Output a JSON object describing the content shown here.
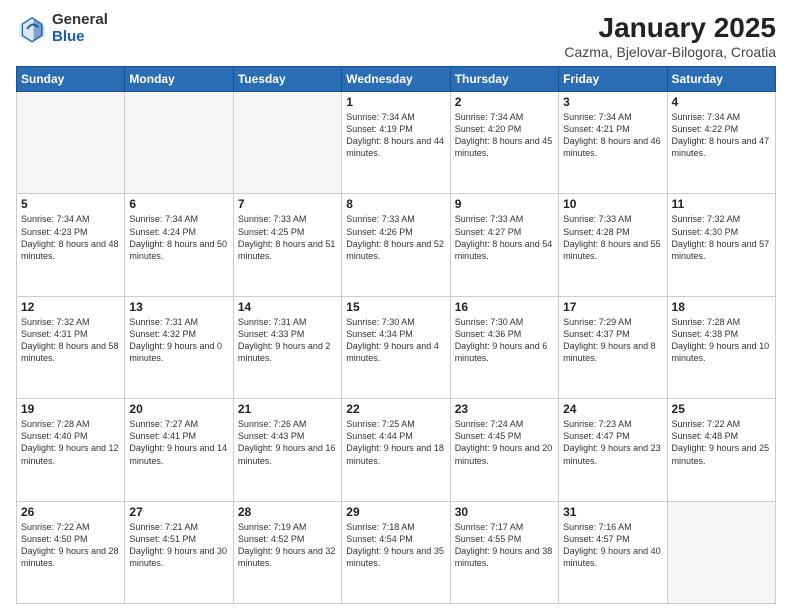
{
  "logo": {
    "general": "General",
    "blue": "Blue"
  },
  "title": {
    "month": "January 2025",
    "location": "Cazma, Bjelovar-Bilogora, Croatia"
  },
  "weekdays": [
    "Sunday",
    "Monday",
    "Tuesday",
    "Wednesday",
    "Thursday",
    "Friday",
    "Saturday"
  ],
  "weeks": [
    [
      {
        "day": "",
        "empty": true
      },
      {
        "day": "",
        "empty": true
      },
      {
        "day": "",
        "empty": true
      },
      {
        "day": "1",
        "sunrise": "7:34 AM",
        "sunset": "4:19 PM",
        "daylight": "8 hours and 44 minutes."
      },
      {
        "day": "2",
        "sunrise": "7:34 AM",
        "sunset": "4:20 PM",
        "daylight": "8 hours and 45 minutes."
      },
      {
        "day": "3",
        "sunrise": "7:34 AM",
        "sunset": "4:21 PM",
        "daylight": "8 hours and 46 minutes."
      },
      {
        "day": "4",
        "sunrise": "7:34 AM",
        "sunset": "4:22 PM",
        "daylight": "8 hours and 47 minutes."
      }
    ],
    [
      {
        "day": "5",
        "sunrise": "7:34 AM",
        "sunset": "4:23 PM",
        "daylight": "8 hours and 48 minutes."
      },
      {
        "day": "6",
        "sunrise": "7:34 AM",
        "sunset": "4:24 PM",
        "daylight": "8 hours and 50 minutes."
      },
      {
        "day": "7",
        "sunrise": "7:33 AM",
        "sunset": "4:25 PM",
        "daylight": "8 hours and 51 minutes."
      },
      {
        "day": "8",
        "sunrise": "7:33 AM",
        "sunset": "4:26 PM",
        "daylight": "8 hours and 52 minutes."
      },
      {
        "day": "9",
        "sunrise": "7:33 AM",
        "sunset": "4:27 PM",
        "daylight": "8 hours and 54 minutes."
      },
      {
        "day": "10",
        "sunrise": "7:33 AM",
        "sunset": "4:28 PM",
        "daylight": "8 hours and 55 minutes."
      },
      {
        "day": "11",
        "sunrise": "7:32 AM",
        "sunset": "4:30 PM",
        "daylight": "8 hours and 57 minutes."
      }
    ],
    [
      {
        "day": "12",
        "sunrise": "7:32 AM",
        "sunset": "4:31 PM",
        "daylight": "8 hours and 58 minutes."
      },
      {
        "day": "13",
        "sunrise": "7:31 AM",
        "sunset": "4:32 PM",
        "daylight": "9 hours and 0 minutes."
      },
      {
        "day": "14",
        "sunrise": "7:31 AM",
        "sunset": "4:33 PM",
        "daylight": "9 hours and 2 minutes."
      },
      {
        "day": "15",
        "sunrise": "7:30 AM",
        "sunset": "4:34 PM",
        "daylight": "9 hours and 4 minutes."
      },
      {
        "day": "16",
        "sunrise": "7:30 AM",
        "sunset": "4:36 PM",
        "daylight": "9 hours and 6 minutes."
      },
      {
        "day": "17",
        "sunrise": "7:29 AM",
        "sunset": "4:37 PM",
        "daylight": "9 hours and 8 minutes."
      },
      {
        "day": "18",
        "sunrise": "7:28 AM",
        "sunset": "4:38 PM",
        "daylight": "9 hours and 10 minutes."
      }
    ],
    [
      {
        "day": "19",
        "sunrise": "7:28 AM",
        "sunset": "4:40 PM",
        "daylight": "9 hours and 12 minutes."
      },
      {
        "day": "20",
        "sunrise": "7:27 AM",
        "sunset": "4:41 PM",
        "daylight": "9 hours and 14 minutes."
      },
      {
        "day": "21",
        "sunrise": "7:26 AM",
        "sunset": "4:43 PM",
        "daylight": "9 hours and 16 minutes."
      },
      {
        "day": "22",
        "sunrise": "7:25 AM",
        "sunset": "4:44 PM",
        "daylight": "9 hours and 18 minutes."
      },
      {
        "day": "23",
        "sunrise": "7:24 AM",
        "sunset": "4:45 PM",
        "daylight": "9 hours and 20 minutes."
      },
      {
        "day": "24",
        "sunrise": "7:23 AM",
        "sunset": "4:47 PM",
        "daylight": "9 hours and 23 minutes."
      },
      {
        "day": "25",
        "sunrise": "7:22 AM",
        "sunset": "4:48 PM",
        "daylight": "9 hours and 25 minutes."
      }
    ],
    [
      {
        "day": "26",
        "sunrise": "7:22 AM",
        "sunset": "4:50 PM",
        "daylight": "9 hours and 28 minutes."
      },
      {
        "day": "27",
        "sunrise": "7:21 AM",
        "sunset": "4:51 PM",
        "daylight": "9 hours and 30 minutes."
      },
      {
        "day": "28",
        "sunrise": "7:19 AM",
        "sunset": "4:52 PM",
        "daylight": "9 hours and 32 minutes."
      },
      {
        "day": "29",
        "sunrise": "7:18 AM",
        "sunset": "4:54 PM",
        "daylight": "9 hours and 35 minutes."
      },
      {
        "day": "30",
        "sunrise": "7:17 AM",
        "sunset": "4:55 PM",
        "daylight": "9 hours and 38 minutes."
      },
      {
        "day": "31",
        "sunrise": "7:16 AM",
        "sunset": "4:57 PM",
        "daylight": "9 hours and 40 minutes."
      },
      {
        "day": "",
        "empty": true,
        "last": true
      }
    ]
  ]
}
